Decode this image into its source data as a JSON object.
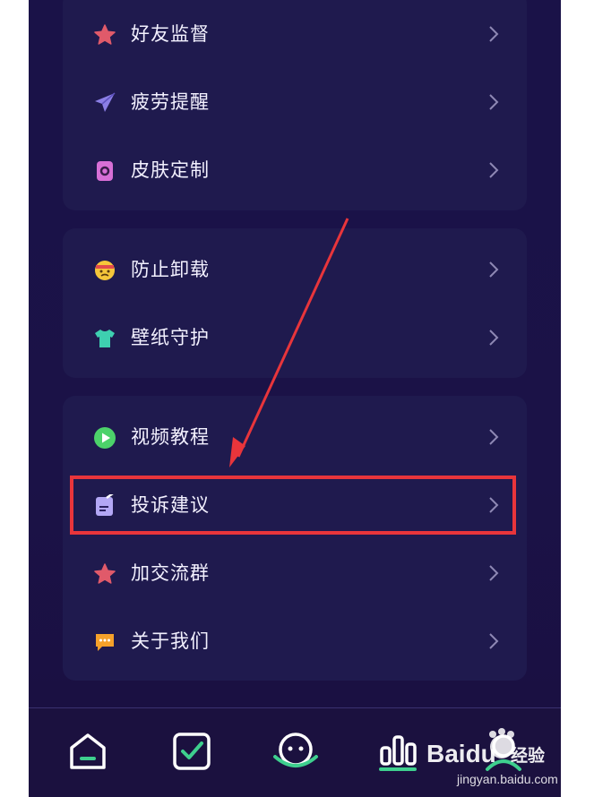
{
  "groups": [
    {
      "items": [
        {
          "label": "好友监督",
          "icon": "star-icon"
        },
        {
          "label": "疲劳提醒",
          "icon": "paper-plane-icon"
        },
        {
          "label": "皮肤定制",
          "icon": "skin-icon"
        }
      ]
    },
    {
      "items": [
        {
          "label": "防止卸载",
          "icon": "angry-face-icon"
        },
        {
          "label": "壁纸守护",
          "icon": "tshirt-icon"
        }
      ]
    },
    {
      "items": [
        {
          "label": "视频教程",
          "icon": "play-icon"
        },
        {
          "label": "投诉建议",
          "icon": "feedback-icon"
        },
        {
          "label": "加交流群",
          "icon": "star-icon"
        },
        {
          "label": "关于我们",
          "icon": "chat-bubble-icon"
        }
      ]
    }
  ],
  "bottom_nav": [
    "home-icon",
    "checklist-icon",
    "planet-icon",
    "stats-icon",
    "profile-icon"
  ],
  "watermark": {
    "brand": "Baidu",
    "suffix": "经验",
    "url": "jingyan.baidu.com"
  },
  "colors": {
    "background": "#1a1248",
    "card": "#1f1a4e",
    "highlight": "#e8353b",
    "accent_green": "#3ecf8e",
    "star": "#e05a6a"
  }
}
